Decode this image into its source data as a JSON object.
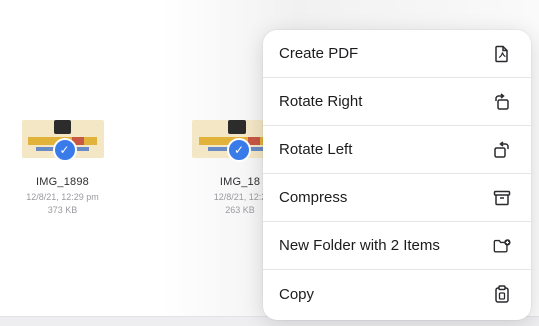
{
  "files": [
    {
      "name": "IMG_1898",
      "date": "12/8/21, 12:29 pm",
      "size": "373 KB"
    },
    {
      "name": "IMG_18",
      "date": "12/8/21, 12:2",
      "size": "263 KB"
    }
  ],
  "context_menu": {
    "items": [
      {
        "label": "Create PDF",
        "icon": "create-pdf-icon"
      },
      {
        "label": "Rotate Right",
        "icon": "rotate-right-icon"
      },
      {
        "label": "Rotate Left",
        "icon": "rotate-left-icon"
      },
      {
        "label": "Compress",
        "icon": "archive-box-icon"
      },
      {
        "label": "New Folder with 2 Items",
        "icon": "folder-badge-plus-icon"
      },
      {
        "label": "Copy",
        "icon": "copy-clipboard-icon"
      }
    ]
  },
  "colors": {
    "selection_accent": "#3a7bea"
  }
}
